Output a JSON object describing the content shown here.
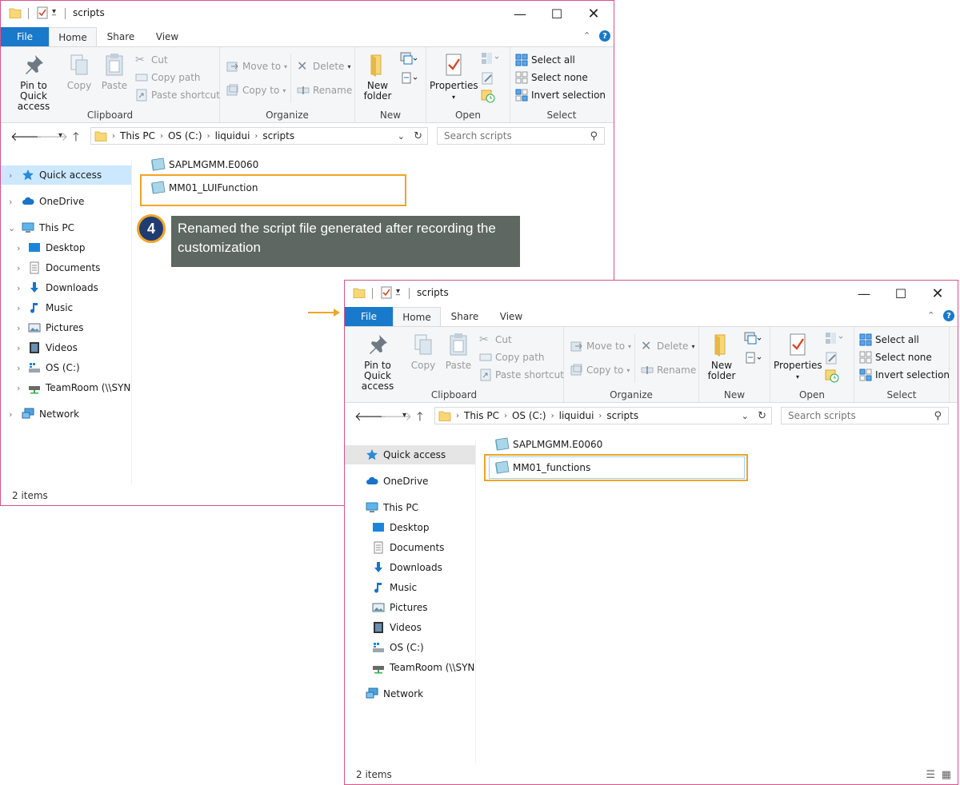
{
  "window1": {
    "title": "scripts",
    "tabs": {
      "file": "File",
      "home": "Home",
      "share": "Share",
      "view": "View"
    },
    "ribbon": {
      "clipboard": {
        "label": "Clipboard",
        "pin": "Pin to Quick\naccess",
        "copy": "Copy",
        "paste": "Paste",
        "cut": "Cut",
        "copy_path": "Copy path",
        "paste_shortcut": "Paste shortcut"
      },
      "organize": {
        "label": "Organize",
        "move_to": "Move to",
        "copy_to": "Copy to",
        "delete": "Delete",
        "rename": "Rename"
      },
      "new": {
        "label": "New",
        "new_folder": "New\nfolder"
      },
      "open": {
        "label": "Open",
        "properties": "Properties"
      },
      "select": {
        "label": "Select",
        "select_all": "Select all",
        "select_none": "Select none",
        "invert_selection": "Invert selection"
      }
    },
    "address": {
      "crumbs": [
        "This PC",
        "OS (C:)",
        "liquidui",
        "scripts"
      ]
    },
    "search_placeholder": "Search scripts",
    "nav": [
      "Quick access",
      "OneDrive",
      "This PC",
      "Desktop",
      "Documents",
      "Downloads",
      "Music",
      "Pictures",
      "Videos",
      "OS (C:)",
      "TeamRoom (\\\\SYNC",
      "Network"
    ],
    "files": [
      "SAPLMGMM.E0060",
      "MM01_LUIFunction"
    ],
    "status": "2 items"
  },
  "window2": {
    "title": "scripts",
    "tabs": {
      "file": "File",
      "home": "Home",
      "share": "Share",
      "view": "View"
    },
    "ribbon": {
      "clipboard": {
        "label": "Clipboard",
        "pin": "Pin to Quick\naccess",
        "copy": "Copy",
        "paste": "Paste",
        "cut": "Cut",
        "copy_path": "Copy path",
        "paste_shortcut": "Paste shortcut"
      },
      "organize": {
        "label": "Organize",
        "move_to": "Move to",
        "copy_to": "Copy to",
        "delete": "Delete",
        "rename": "Rename"
      },
      "new": {
        "label": "New",
        "new_folder": "New\nfolder"
      },
      "open": {
        "label": "Open",
        "properties": "Properties"
      },
      "select": {
        "label": "Select",
        "select_all": "Select all",
        "select_none": "Select none",
        "invert_selection": "Invert selection"
      }
    },
    "address": {
      "crumbs": [
        "This PC",
        "OS (C:)",
        "liquidui",
        "scripts"
      ]
    },
    "search_placeholder": "Search scripts",
    "nav": [
      "Quick access",
      "OneDrive",
      "This PC",
      "Desktop",
      "Documents",
      "Downloads",
      "Music",
      "Pictures",
      "Videos",
      "OS (C:)",
      "TeamRoom (\\\\SYNC",
      "Network"
    ],
    "files": [
      "SAPLMGMM.E0060",
      "MM01_functions"
    ],
    "status": "2 items"
  },
  "callout": {
    "step": "4",
    "text": "Renamed the script file generated after recording the customization"
  },
  "colors": {
    "accent": "#1979ca",
    "highlight": "#f0a526",
    "window_border": "#d9548a",
    "callout_bg": "#5e6762",
    "badge": "#1e3c72"
  }
}
